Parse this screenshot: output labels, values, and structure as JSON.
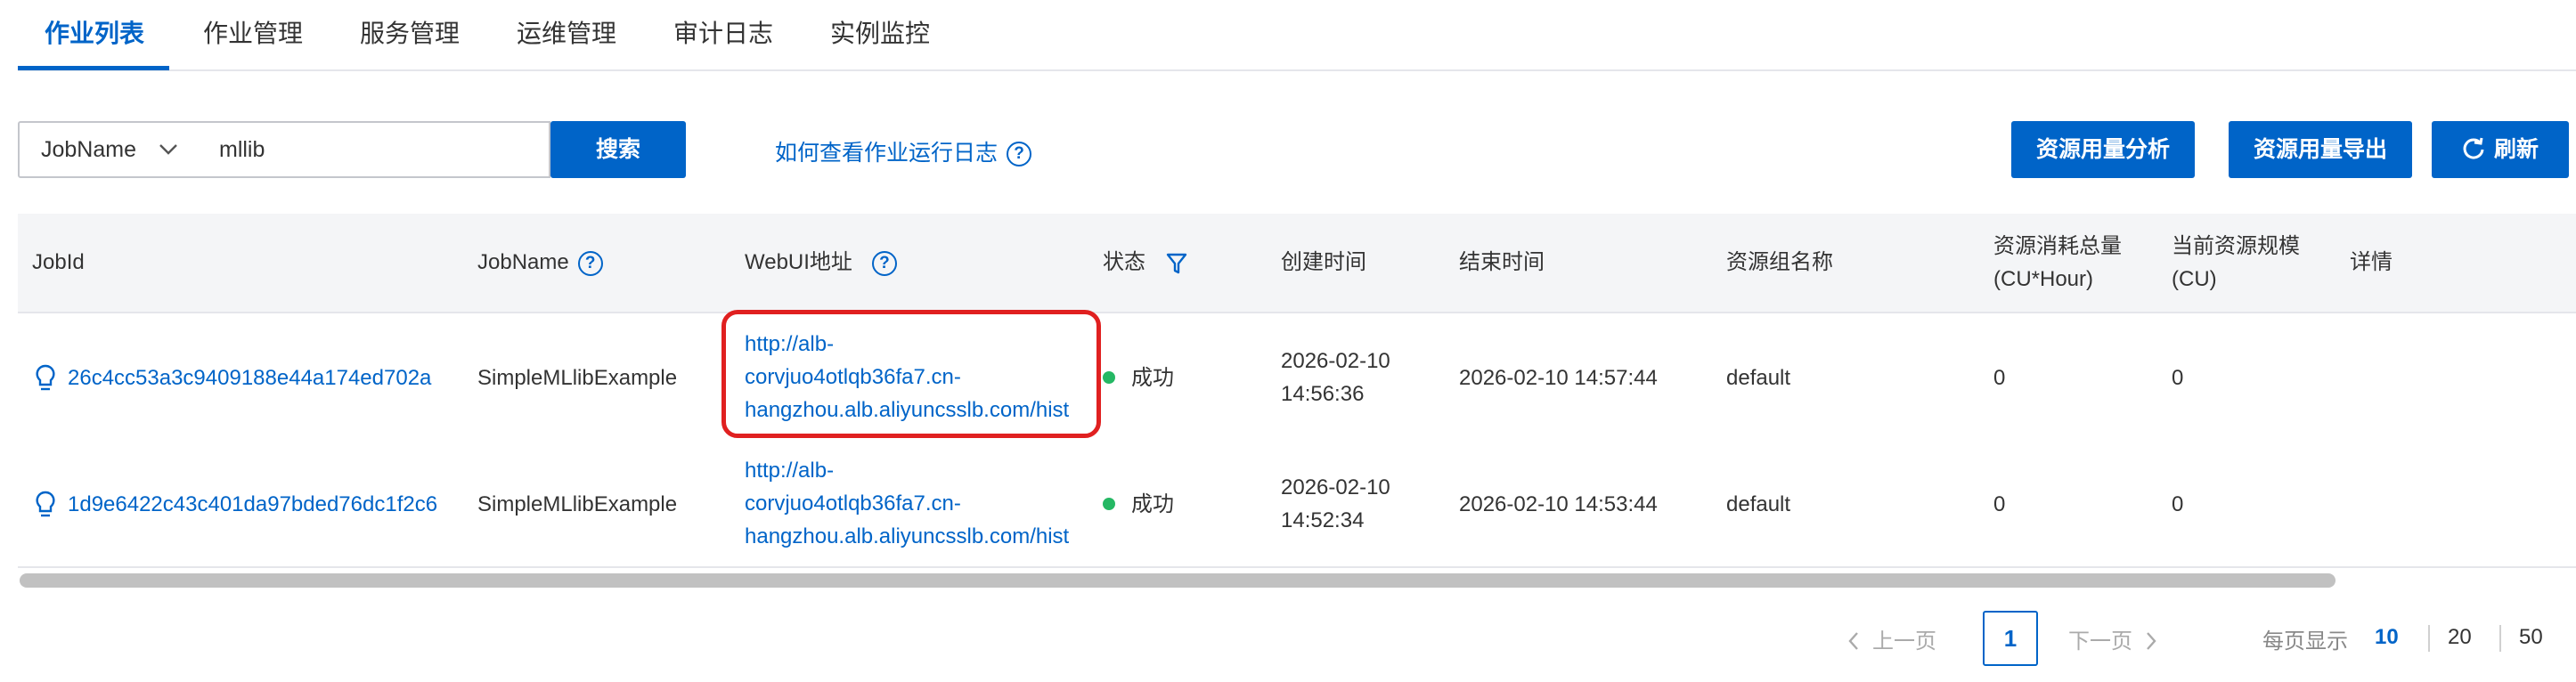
{
  "tabs": [
    {
      "label": "作业列表"
    },
    {
      "label": "作业管理"
    },
    {
      "label": "服务管理"
    },
    {
      "label": "运维管理"
    },
    {
      "label": "审计日志"
    },
    {
      "label": "实例监控"
    }
  ],
  "search": {
    "field_selected": "JobName",
    "value": "mllib",
    "button_label": "搜索",
    "help_link": "如何查看作业运行日志"
  },
  "toolbar": {
    "usage_analysis_label": "资源用量分析",
    "usage_export_label": "资源用量导出",
    "refresh_label": "刷新"
  },
  "table": {
    "headers": {
      "job_id": "JobId",
      "job_name": "JobName",
      "webui": "WebUI地址",
      "status": "状态",
      "created": "创建时间",
      "ended": "结束时间",
      "group": "资源组名称",
      "usage_line1": "资源消耗总量",
      "usage_line2": "(CU*Hour)",
      "scale_line1": "当前资源规模",
      "scale_line2": "(CU)",
      "detail": "详情"
    },
    "rows": [
      {
        "job_id": "26c4cc53a3c9409188e44a174ed702a",
        "job_name": "SimpleMLlibExample",
        "webui_line1": "http://alb-",
        "webui_line2": "corvjuo4otlqb36fa7.cn-",
        "webui_line3": "hangzhou.alb.aliyuncsslb.com/hist",
        "status": "成功",
        "created_date": "2026-02-10",
        "created_time": "14:56:36",
        "ended": "2026-02-10 14:57:44",
        "group": "default",
        "usage": "0",
        "scale": "0"
      },
      {
        "job_id": "1d9e6422c43c401da97bded76dc1f2c6",
        "job_name": "SimpleMLlibExample",
        "webui_line1": "http://alb-",
        "webui_line2": "corvjuo4otlqb36fa7.cn-",
        "webui_line3": "hangzhou.alb.aliyuncsslb.com/hist",
        "status": "成功",
        "created_date": "2026-02-10",
        "created_time": "14:52:34",
        "ended": "2026-02-10 14:53:44",
        "group": "default",
        "usage": "0",
        "scale": "0"
      }
    ]
  },
  "pagination": {
    "prev_label": "上一页",
    "current_page": "1",
    "next_label": "下一页",
    "page_size_label": "每页显示",
    "page_sizes": [
      "10",
      "20",
      "50"
    ],
    "selected_page_size": "10"
  },
  "colors": {
    "primary": "#0064c8",
    "success": "#25b864",
    "highlight": "#e02020"
  }
}
